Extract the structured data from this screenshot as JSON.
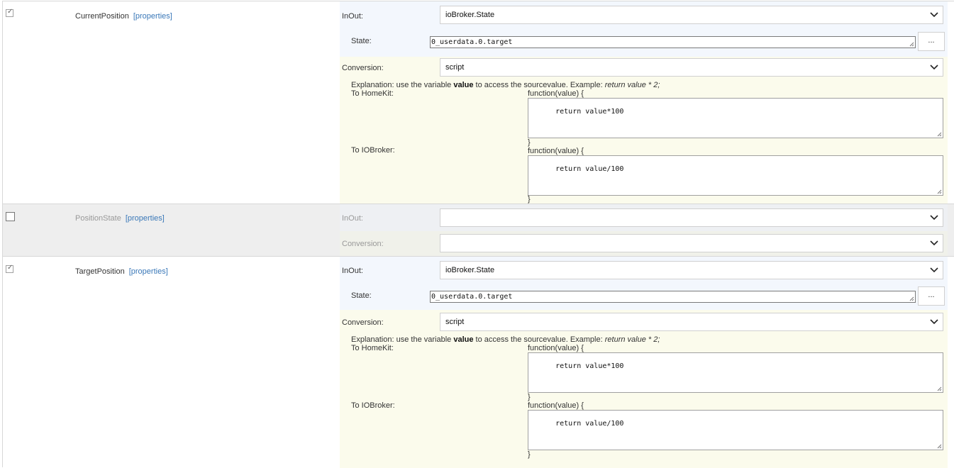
{
  "characteristics": [
    {
      "id": "current",
      "enabled": true,
      "name": "CurrentPosition",
      "properties_link": "[properties]",
      "inout_label": "InOut:",
      "inout_value": "ioBroker.State",
      "state_label": "State:",
      "state_value": "0_userdata.0.target",
      "browse_label": "...",
      "conversion_label": "Conversion:",
      "conversion_value": "script",
      "explanation_prefix": "Explanation: use the variable ",
      "explanation_bold": "value",
      "explanation_mid": " to access the sourcevalue. Example: ",
      "explanation_example": "return value * 2;",
      "to_homekit_label": "To HomeKit:",
      "to_homekit_fn_open": "function(value) {",
      "to_homekit_code": "return value*100",
      "to_homekit_fn_close": "}",
      "to_iobroker_label": "To IOBroker:",
      "to_iobroker_fn_open": "function(value) {",
      "to_iobroker_code": "return value/100",
      "to_iobroker_fn_close": "}"
    },
    {
      "id": "positionstate",
      "enabled": false,
      "name": "PositionState",
      "properties_link": "[properties]",
      "inout_label": "InOut:",
      "inout_value": "",
      "conversion_label": "Conversion:",
      "conversion_value": ""
    },
    {
      "id": "target",
      "enabled": true,
      "name": "TargetPosition",
      "properties_link": "[properties]",
      "inout_label": "InOut:",
      "inout_value": "ioBroker.State",
      "state_label": "State:",
      "state_value": "0_userdata.0.target",
      "browse_label": "...",
      "conversion_label": "Conversion:",
      "conversion_value": "script",
      "explanation_prefix": "Explanation: use the variable ",
      "explanation_bold": "value",
      "explanation_mid": " to access the sourcevalue. Example: ",
      "explanation_example": "return value * 2;",
      "to_homekit_label": "To HomeKit:",
      "to_homekit_fn_open": "function(value) {",
      "to_homekit_code": "return value*100",
      "to_homekit_fn_close": "}",
      "to_iobroker_label": "To IOBroker:",
      "to_iobroker_fn_open": "function(value) {",
      "to_iobroker_code": "return value/100",
      "to_iobroker_fn_close": "}"
    }
  ],
  "icons": {
    "checkbox_checked": "check-icon",
    "select_arrow": "chevron-down-icon",
    "resize_grip": "resize-grip-icon"
  },
  "colors": {
    "link": "#3a78b8",
    "band_inout": "#f3f7fd",
    "band_conversion": "#fbfbec",
    "disabled_row": "#eeeeee"
  }
}
